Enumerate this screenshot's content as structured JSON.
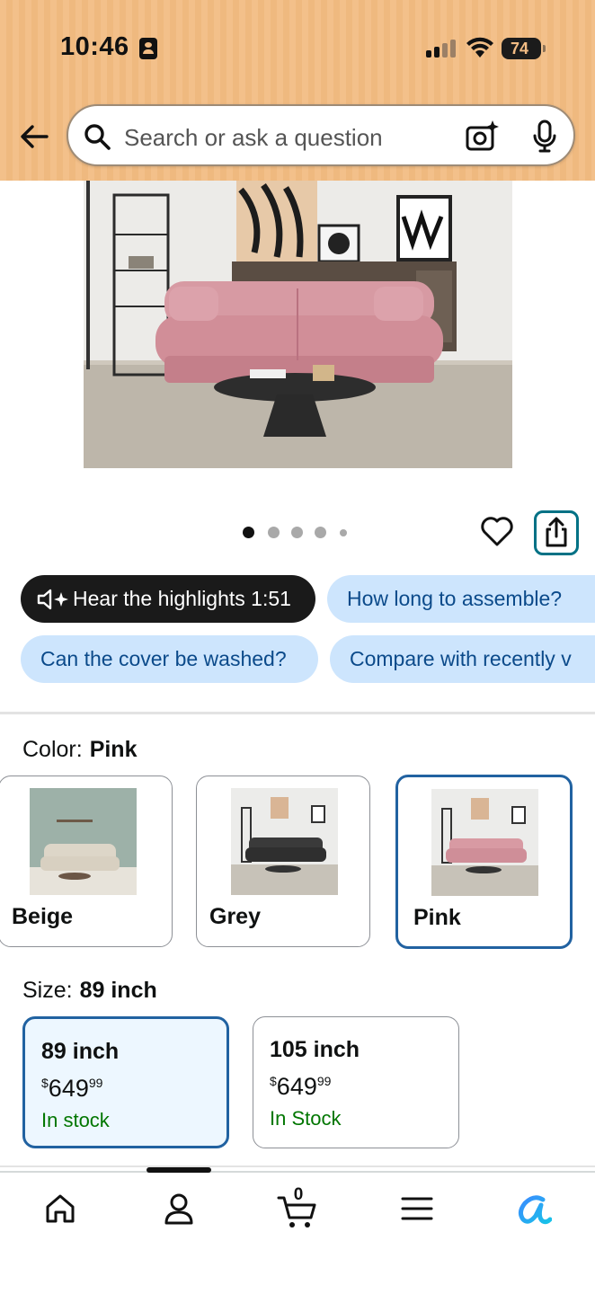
{
  "status_bar": {
    "time": "10:46",
    "battery": "74"
  },
  "search": {
    "placeholder": "Search or ask a question"
  },
  "chips_row1": [
    {
      "label": "Hear the highlights 1:51"
    },
    {
      "label": "How long to assemble?"
    }
  ],
  "chips_row2": [
    {
      "label": "Can the cover be washed?"
    },
    {
      "label": "Compare with recently v"
    }
  ],
  "color": {
    "label": "Color:",
    "selected": "Pink",
    "options": [
      {
        "label": "Beige"
      },
      {
        "label": "Grey"
      },
      {
        "label": "Pink"
      }
    ]
  },
  "size": {
    "label": "Size:",
    "selected": "89 inch",
    "options": [
      {
        "name": "89 inch",
        "currency": "$",
        "price_whole": "649",
        "price_fraction": "99",
        "stock": "In stock"
      },
      {
        "name": "105 inch",
        "currency": "$",
        "price_whole": "649",
        "price_fraction": "99",
        "stock": "In Stock"
      }
    ]
  },
  "cart": {
    "count": "0"
  },
  "carousel": {
    "pages": 5,
    "current": 1
  },
  "colors": {
    "accent": "#2162a1",
    "header": "#f3c08a",
    "stock": "#007600",
    "chip": "#cde5fd",
    "share_border": "#007185"
  },
  "icons": [
    "back-arrow-icon",
    "search-icon",
    "camera-icon",
    "microphone-icon",
    "heart-icon",
    "share-icon",
    "speaker-sparkle-icon",
    "home-icon",
    "profile-icon",
    "cart-icon",
    "menu-icon",
    "rufus-icon"
  ]
}
